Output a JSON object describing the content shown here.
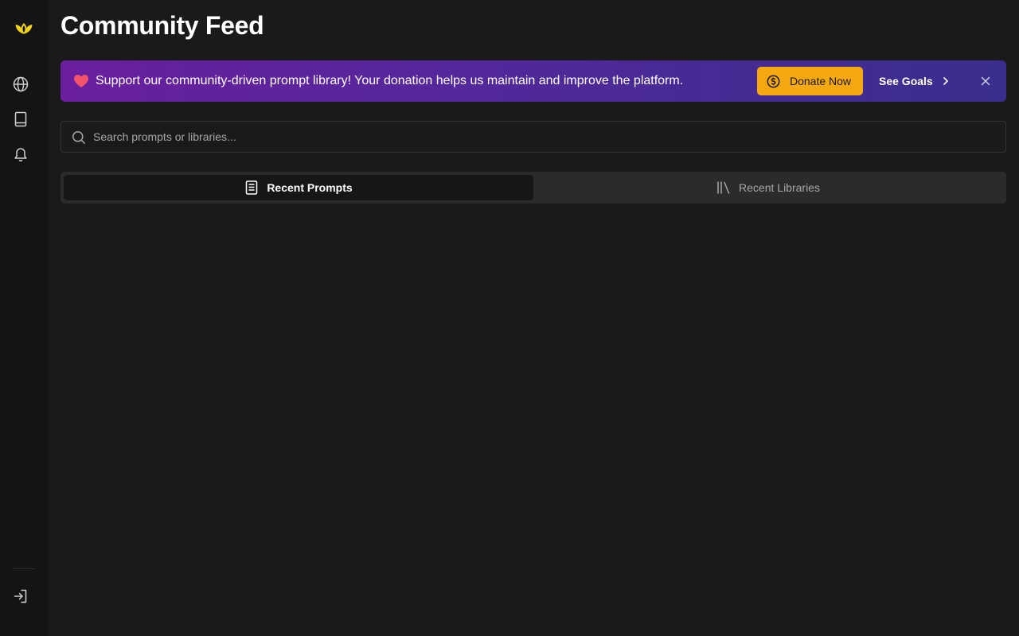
{
  "sidebar": {
    "logo": "lotus-logo-icon",
    "items": [
      {
        "icon": "globe-icon"
      },
      {
        "icon": "book-icon"
      },
      {
        "icon": "bell-icon"
      }
    ],
    "footer": {
      "icon": "login-icon"
    }
  },
  "page": {
    "title": "Community Feed"
  },
  "banner": {
    "heart_icon": "heart-icon",
    "text": "Support our community-driven prompt library! Your donation helps us maintain and improve the platform.",
    "donate_label": "Donate Now",
    "goals_label": "See Goals",
    "colors": {
      "gradient_start": "#6a1f9e",
      "gradient_end": "#3a2e8c",
      "donate_bg": "#f5a80f"
    }
  },
  "search": {
    "placeholder": "Search prompts or libraries...",
    "value": ""
  },
  "tabs": [
    {
      "label": "Recent Prompts",
      "icon": "document-icon",
      "active": true
    },
    {
      "label": "Recent Libraries",
      "icon": "library-icon",
      "active": false
    }
  ],
  "colors": {
    "background": "#1a1a1a",
    "sidebar": "#141414",
    "accent": "#f5c400"
  }
}
